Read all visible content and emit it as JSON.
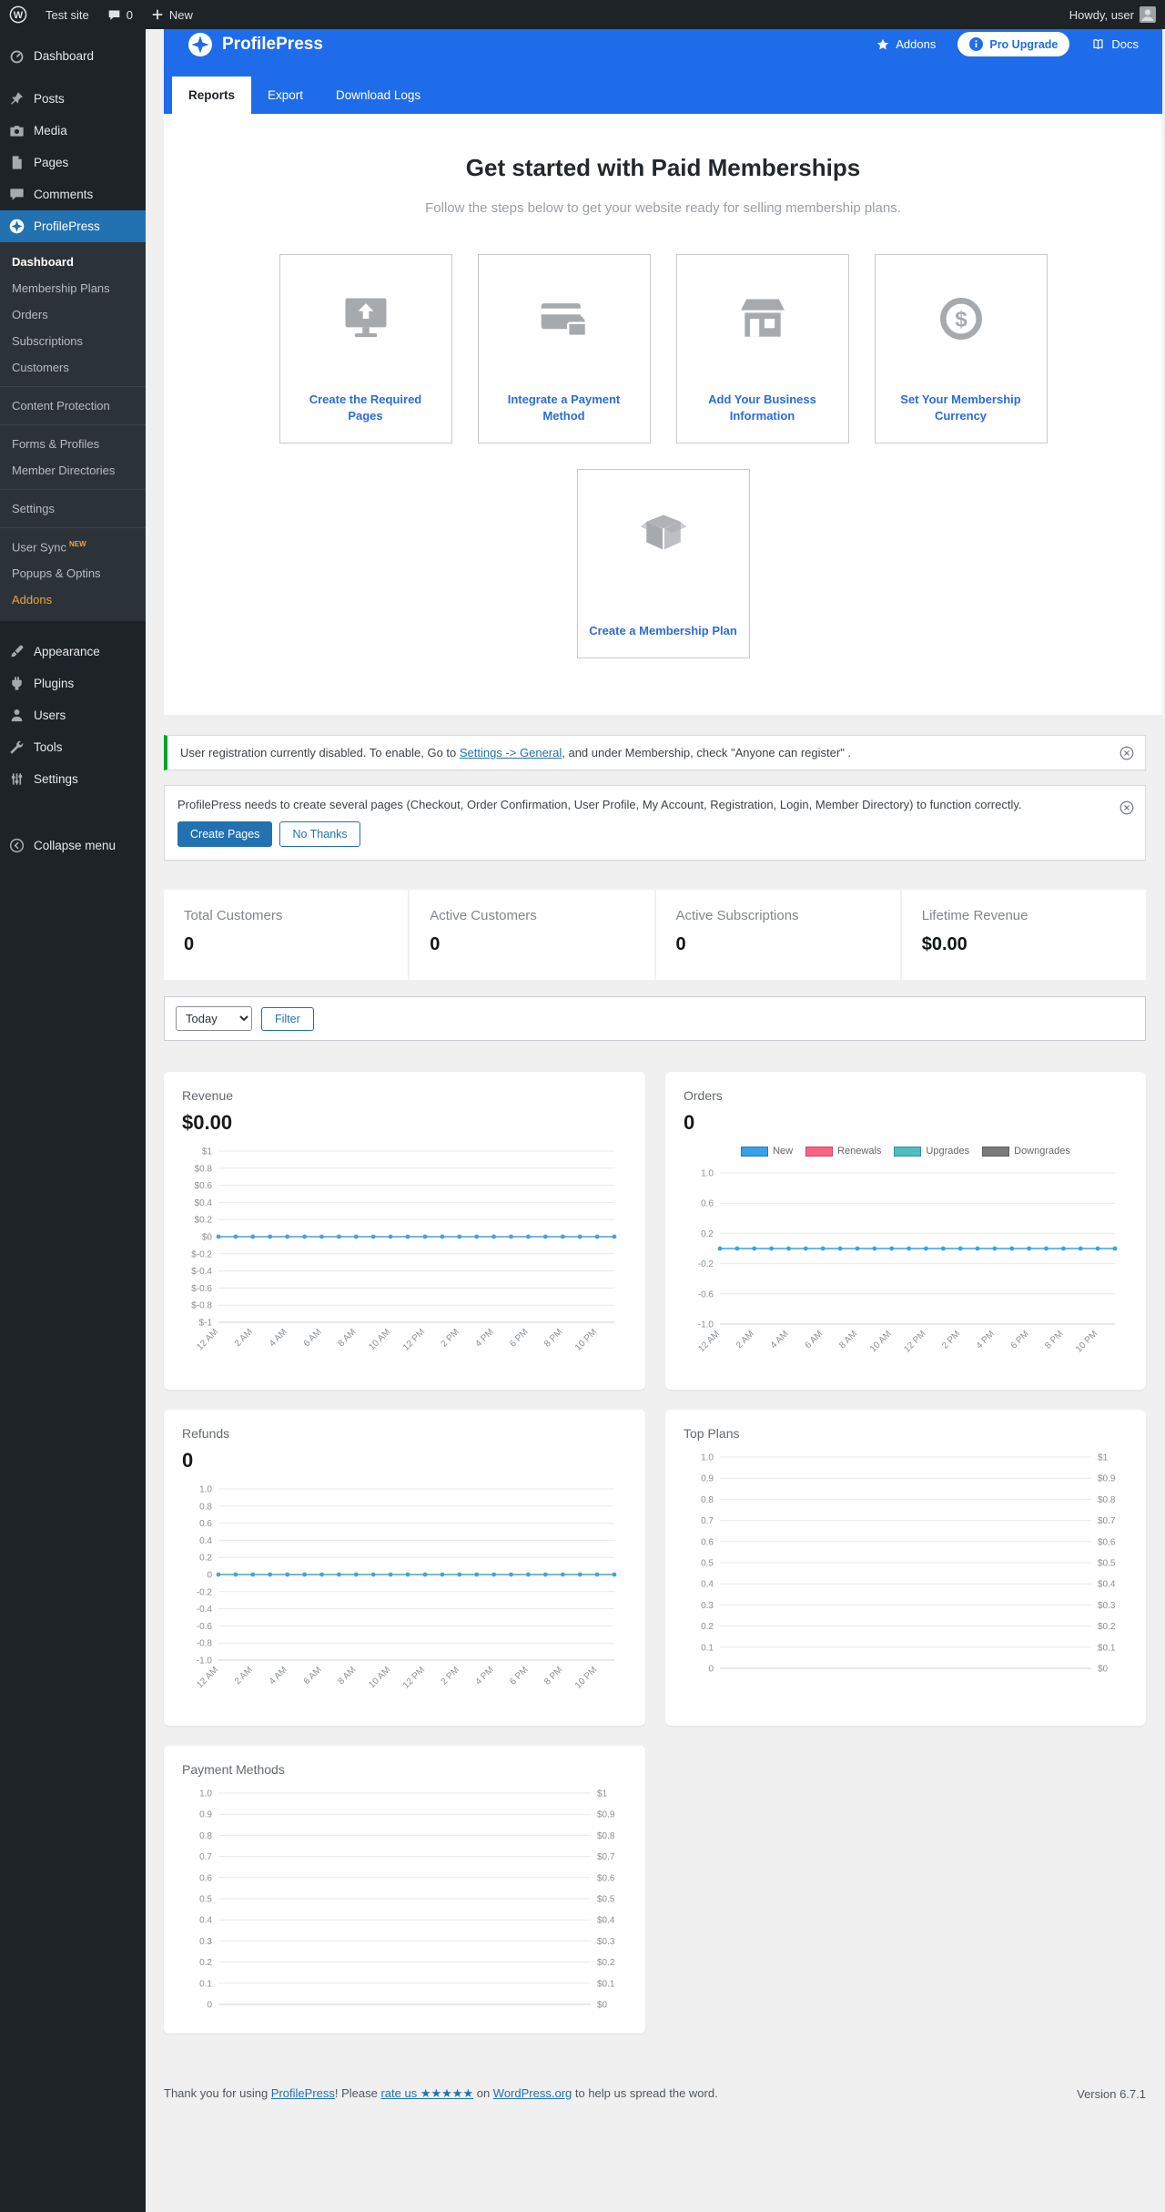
{
  "admin_bar": {
    "site_name": "Test site",
    "comments_count": "0",
    "new_label": "New",
    "howdy": "Howdy, user"
  },
  "sidebar": {
    "top": [
      {
        "label": "Dashboard",
        "icon": "dashboard-icon"
      },
      {
        "label": "Posts",
        "icon": "pin-icon"
      },
      {
        "label": "Media",
        "icon": "media-icon"
      },
      {
        "label": "Pages",
        "icon": "pages-icon"
      },
      {
        "label": "Comments",
        "icon": "comment-icon"
      },
      {
        "label": "ProfilePress",
        "icon": "profilepress-icon",
        "active": true
      }
    ],
    "submenu_groups": [
      [
        {
          "label": "Dashboard",
          "current": true
        },
        {
          "label": "Membership Plans"
        },
        {
          "label": "Orders"
        },
        {
          "label": "Subscriptions"
        },
        {
          "label": "Customers"
        }
      ],
      [
        {
          "label": "Content Protection"
        }
      ],
      [
        {
          "label": "Forms & Profiles"
        },
        {
          "label": "Member Directories"
        }
      ],
      [
        {
          "label": "Settings"
        }
      ],
      [
        {
          "label": "User Sync",
          "badge": "NEW"
        },
        {
          "label": "Popups & Optins"
        },
        {
          "label": "Addons",
          "accent": true
        }
      ]
    ],
    "bottom": [
      {
        "label": "Appearance",
        "icon": "appearance-icon"
      },
      {
        "label": "Plugins",
        "icon": "plugin-icon"
      },
      {
        "label": "Users",
        "icon": "users-icon"
      },
      {
        "label": "Tools",
        "icon": "tools-icon"
      },
      {
        "label": "Settings",
        "icon": "settings-icon"
      }
    ],
    "collapse": {
      "label": "Collapse menu",
      "icon": "collapse-icon"
    }
  },
  "header": {
    "brand": "ProfilePress",
    "nav": {
      "addons": "Addons",
      "pro_upgrade": "Pro Upgrade",
      "docs": "Docs"
    },
    "tabs": [
      {
        "label": "Reports",
        "active": true
      },
      {
        "label": "Export"
      },
      {
        "label": "Download Logs"
      }
    ]
  },
  "onboarding": {
    "title": "Get started with Paid Memberships",
    "subtitle": "Follow the steps below to get your website ready for selling membership plans.",
    "cards": [
      {
        "label": "Create the Required Pages",
        "icon": "monitor-upload-icon"
      },
      {
        "label": "Integrate a Payment Method",
        "icon": "card-lock-icon"
      },
      {
        "label": "Add Your Business Information",
        "icon": "store-icon"
      },
      {
        "label": "Set Your Membership Currency",
        "icon": "currency-icon"
      },
      {
        "label": "Create a Membership Plan",
        "icon": "plan-box-icon"
      }
    ]
  },
  "notices": [
    {
      "before": "User registration currently disabled. To enable, Go to ",
      "link": "Settings -> General",
      "after": ", and under Membership, check \"Anyone can register\" ."
    },
    {
      "text": "ProfilePress needs to create several pages (Checkout, Order Confirmation, User Profile, My Account, Registration, Login, Member Directory) to function correctly.",
      "primary_button": "Create Pages",
      "secondary_button": "No Thanks"
    }
  ],
  "stats": [
    {
      "label": "Total Customers",
      "value": "0"
    },
    {
      "label": "Active Customers",
      "value": "0"
    },
    {
      "label": "Active Subscriptions",
      "value": "0"
    },
    {
      "label": "Lifetime Revenue",
      "value": "$0.00"
    }
  ],
  "filter": {
    "selected": "Today",
    "button_label": "Filter"
  },
  "chart_data": [
    {
      "id": "revenue",
      "type": "line",
      "title": "Revenue",
      "value_label": "$0.00",
      "ylim": [
        -1,
        1
      ],
      "left_ticks": [
        "$1",
        "$0.8",
        "$0.6",
        "$0.4",
        "$0.2",
        "$0",
        "$-0.2",
        "$-0.4",
        "$-0.6",
        "$-0.8",
        "$-1"
      ],
      "x_labels": [
        "12 AM",
        "2 AM",
        "4 AM",
        "6 AM",
        "8 AM",
        "10 AM",
        "12 PM",
        "2 PM",
        "4 PM",
        "6 PM",
        "8 PM",
        "10 PM"
      ],
      "n_points": 24,
      "series": [
        {
          "name": "Revenue",
          "color": "#4d9fd6",
          "values": [
            0,
            0,
            0,
            0,
            0,
            0,
            0,
            0,
            0,
            0,
            0,
            0,
            0,
            0,
            0,
            0,
            0,
            0,
            0,
            0,
            0,
            0,
            0,
            0
          ]
        }
      ]
    },
    {
      "id": "orders",
      "type": "line",
      "title": "Orders",
      "value_label": "0",
      "ylim": [
        -1,
        1
      ],
      "left_ticks": [
        "1.0",
        "0.6",
        "0.2",
        "-0.2",
        "-0.6",
        "-1.0"
      ],
      "x_labels": [
        "12 AM",
        "2 AM",
        "4 AM",
        "6 AM",
        "8 AM",
        "10 AM",
        "12 PM",
        "2 PM",
        "4 PM",
        "6 PM",
        "8 PM",
        "10 PM"
      ],
      "n_points": 24,
      "legend": [
        {
          "label": "New",
          "color": "#36a2eb"
        },
        {
          "label": "Renewals",
          "color": "#ff6384"
        },
        {
          "label": "Upgrades",
          "color": "#4bc0c0"
        },
        {
          "label": "Downgrades",
          "color": "#7b7b7b"
        }
      ],
      "series": [
        {
          "name": "New",
          "color": "#36a2eb",
          "values": [
            0,
            0,
            0,
            0,
            0,
            0,
            0,
            0,
            0,
            0,
            0,
            0,
            0,
            0,
            0,
            0,
            0,
            0,
            0,
            0,
            0,
            0,
            0,
            0
          ]
        }
      ]
    },
    {
      "id": "refunds",
      "type": "line",
      "title": "Refunds",
      "value_label": "0",
      "ylim": [
        -1,
        1
      ],
      "left_ticks": [
        "1.0",
        "0.8",
        "0.6",
        "0.4",
        "0.2",
        "0",
        "-0.2",
        "-0.4",
        "-0.6",
        "-0.8",
        "-1.0"
      ],
      "x_labels": [
        "12 AM",
        "2 AM",
        "4 AM",
        "6 AM",
        "8 AM",
        "10 AM",
        "12 PM",
        "2 PM",
        "4 PM",
        "6 PM",
        "8 PM",
        "10 PM"
      ],
      "n_points": 24,
      "series": [
        {
          "name": "Refunds",
          "color": "#4d9fd6",
          "values": [
            0,
            0,
            0,
            0,
            0,
            0,
            0,
            0,
            0,
            0,
            0,
            0,
            0,
            0,
            0,
            0,
            0,
            0,
            0,
            0,
            0,
            0,
            0,
            0
          ]
        }
      ]
    },
    {
      "id": "top_plans",
      "type": "line",
      "title": "Top Plans",
      "ylim": [
        0,
        1
      ],
      "left_ticks": [
        "1.0",
        "0.9",
        "0.8",
        "0.7",
        "0.6",
        "0.5",
        "0.4",
        "0.3",
        "0.2",
        "0.1",
        "0"
      ],
      "right_ticks": [
        "$1",
        "$0.9",
        "$0.8",
        "$0.7",
        "$0.6",
        "$0.5",
        "$0.4",
        "$0.3",
        "$0.2",
        "$0.1",
        "$0"
      ],
      "series": []
    },
    {
      "id": "payment_methods",
      "type": "line",
      "title": "Payment Methods",
      "ylim": [
        0,
        1
      ],
      "left_ticks": [
        "1.0",
        "0.9",
        "0.8",
        "0.7",
        "0.6",
        "0.5",
        "0.4",
        "0.3",
        "0.2",
        "0.1",
        "0"
      ],
      "right_ticks": [
        "$1",
        "$0.9",
        "$0.8",
        "$0.7",
        "$0.6",
        "$0.5",
        "$0.4",
        "$0.3",
        "$0.2",
        "$0.1",
        "$0"
      ],
      "series": []
    }
  ],
  "footer": {
    "thanks_1": "Thank you for using ",
    "link_profilepress": "ProfilePress",
    "thanks_2": "! Please ",
    "link_rate": "rate us ★★★★★",
    "thanks_3": " on ",
    "link_wordpress": "WordPress.org",
    "thanks_4": " to help us spread the word.",
    "version": "Version 6.7.1"
  },
  "colors": {
    "header_blue": "#1f6ceb",
    "accent_blue": "#2271b1",
    "success_green": "#00a32a",
    "card_link_blue": "#2c6cd8",
    "chart_line_blue": "#4d9fd6",
    "addons_orange": "#e8a33d",
    "sidebar_dark": "#1d2327",
    "submenu_dark": "#2c3338"
  }
}
